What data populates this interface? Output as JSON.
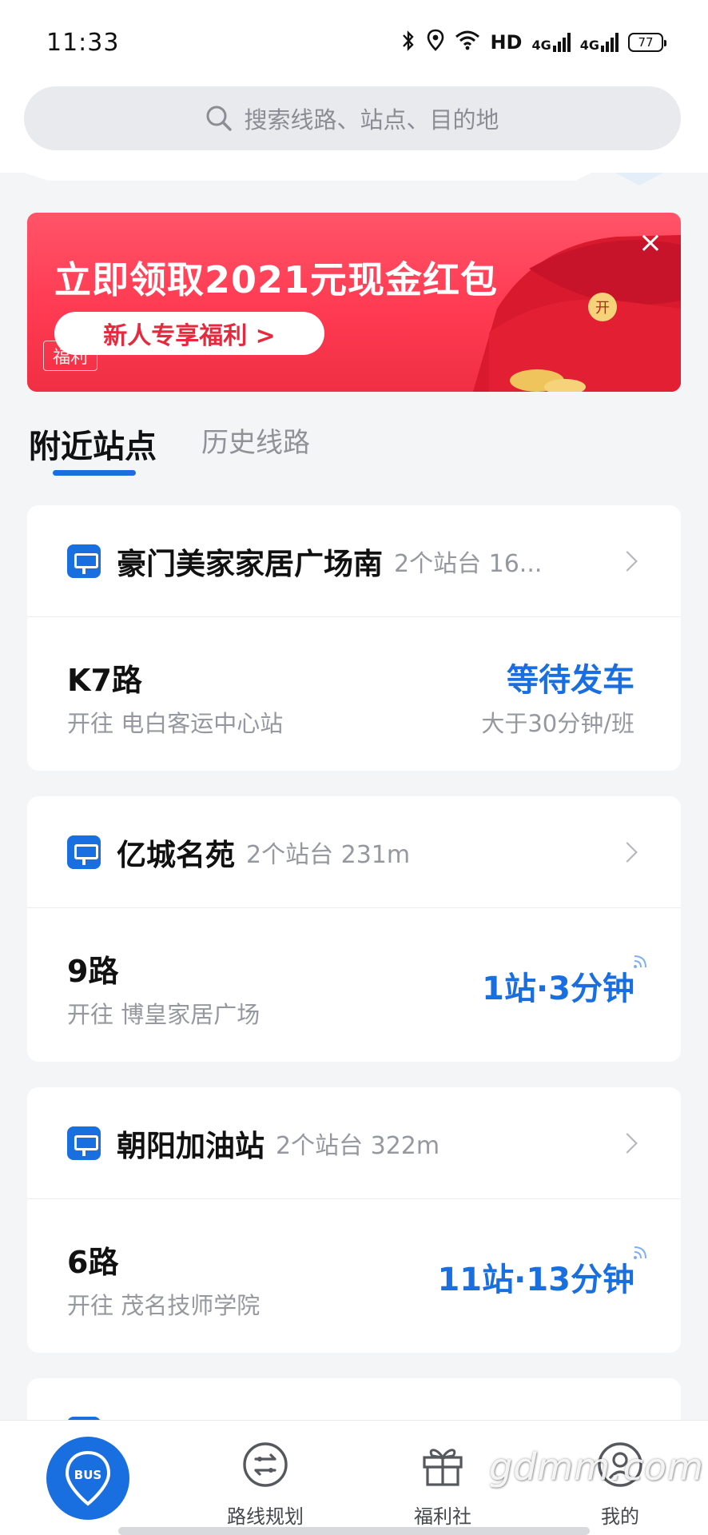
{
  "status_bar": {
    "time": "11:33",
    "net_label_1": "4G",
    "net_label_2": "4G",
    "hd_label": "HD",
    "battery": "77"
  },
  "search": {
    "placeholder": "搜索线路、站点、目的地"
  },
  "banner": {
    "title": "立即领取2021元现金红包",
    "button": "新人专享福利 >",
    "tag": "福利",
    "close": "×"
  },
  "tabs": {
    "nearby": "附近站点",
    "history": "历史线路"
  },
  "stations": [
    {
      "name": "豪门美家家居广场南",
      "meta": "2个站台 16...",
      "route": "K7路",
      "direction": "开往 电白客运中心站",
      "status": "等待发车",
      "status_sub": "大于30分钟/班"
    },
    {
      "name": "亿城名苑",
      "meta": "2个站台 231m",
      "route": "9路",
      "direction": "开往 博皇家居广场",
      "status": "1站·3分钟"
    },
    {
      "name": "朝阳加油站",
      "meta": "2个站台 322m",
      "route": "6路",
      "direction": "开往 茂名技师学院",
      "status": "11站·13分钟"
    }
  ],
  "bottom_nav": {
    "bus_label": "BUS",
    "route_plan": "路线规划",
    "welfare": "福利社",
    "mine": "我的"
  },
  "watermark": "gdmm.com",
  "colors": {
    "accent": "#1a6fe0",
    "banner_red": "#ff3a52",
    "page_bg": "#f4f5f7"
  }
}
